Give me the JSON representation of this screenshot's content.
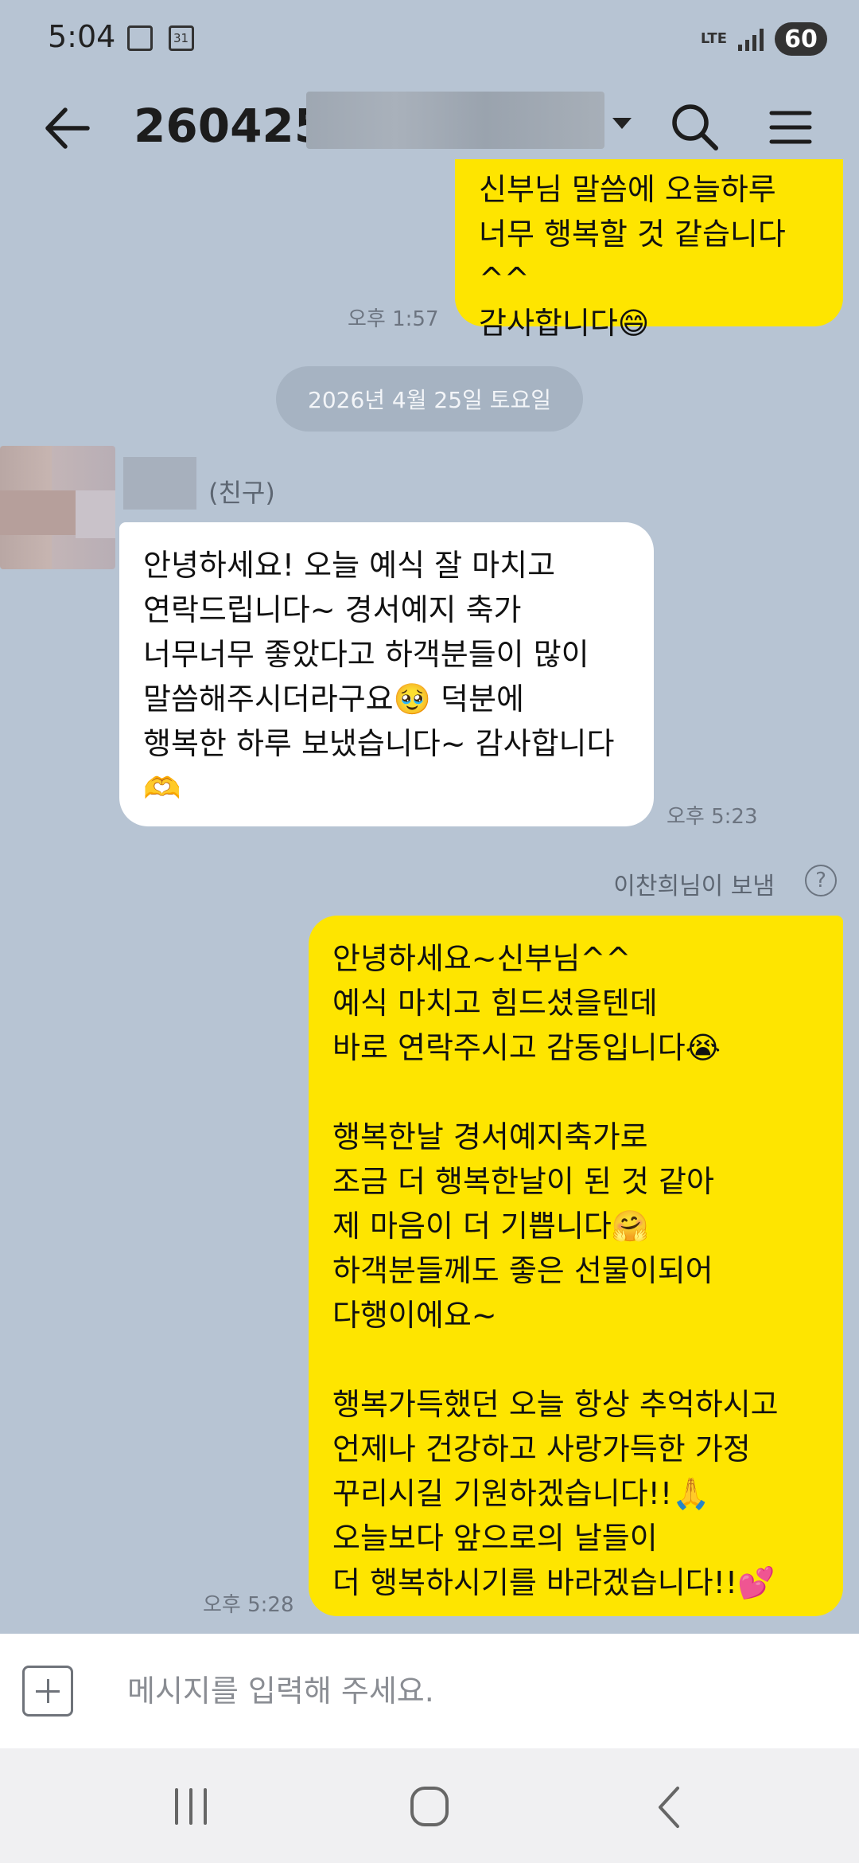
{
  "status_bar": {
    "time": "5:04",
    "network": "LTE",
    "battery": "60"
  },
  "header": {
    "room_title": "260425",
    "icons": [
      "back-arrow-icon",
      "search-icon",
      "menu-icon"
    ]
  },
  "messages": [
    {
      "side": "mine",
      "text": "신부님 말씀에 오늘하루\n너무 행복할 것 같습니다^^\n감사합니다😄",
      "time": "오후 1:57"
    },
    {
      "side": "theirs",
      "sender_tag": "(친구)",
      "text": "안녕하세요! 오늘 예식 잘 마치고\n연락드립니다~ 경서예지 축가\n너무너무 좋았다고 하객분들이 많이\n말씀해주시더라구요🥹 덕분에\n행복한 하루 보냈습니다~ 감사합니다\n🫶",
      "time": "오후 5:23"
    },
    {
      "side": "mine",
      "text": "안녕하세요~신부님^^\n예식 마치고 힘드셨을텐데\n바로 연락주시고 감동입니다😭\n\n행복한날 경서예지축가로\n조금 더 행복한날이 된 것 같아\n제 마음이 더 기쁩니다🤗\n하객분들께도 좋은 선물이되어\n다행이에요~\n\n행복가득했던 오늘 항상 추억하시고\n언제나 건강하고 사랑가득한 가정\n꾸리시길 기원하겠습니다!!🙏\n오늘보다 앞으로의 날들이\n더 행복하시기를 바라겠습니다!!💕",
      "time": "오후 5:28"
    }
  ],
  "date_divider": "2026년 4월 25일 토요일",
  "sent_by_label": "이찬희님이 보냄",
  "help_symbol": "?",
  "input": {
    "placeholder": "메시지를 입력해 주세요."
  },
  "colors": {
    "background": "#b7c4d3",
    "my_bubble": "#fee500",
    "their_bubble": "#ffffff"
  }
}
